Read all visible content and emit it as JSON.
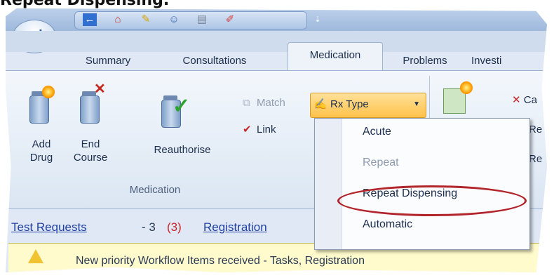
{
  "heading": "Repeat Dispensing.",
  "app": {
    "logo": "emis"
  },
  "qat": {
    "icons": [
      "back-arrow-icon",
      "home-icon",
      "pen-icon",
      "users-icon",
      "database-icon",
      "syringe-icon"
    ],
    "dropdown_glyph": "⇣"
  },
  "tabs": [
    "Summary",
    "Consultations",
    "Medication",
    "Problems",
    "Investi"
  ],
  "active_tab": "Medication",
  "ribbon": {
    "add_drug": [
      "Add",
      "Drug"
    ],
    "end_course": [
      "End",
      "Course"
    ],
    "reauthorise": "Reauthorise",
    "match": "Match",
    "link": "Link",
    "rx_type": "Rx Type",
    "group_label": "Medication",
    "right_partial": [
      "Ca",
      "Re",
      "Re"
    ]
  },
  "rx_menu": {
    "items": [
      {
        "label": "Acute",
        "enabled": true
      },
      {
        "label": "Repeat",
        "enabled": false
      },
      {
        "label": "Repeat Dispensing",
        "enabled": true,
        "highlighted": true
      },
      {
        "label": "Automatic",
        "enabled": true
      }
    ]
  },
  "links_bar": {
    "test_requests": "Test Requests",
    "dash_count": "- 3",
    "red_count": "(3)",
    "registration": "Registration"
  },
  "alert": {
    "text": "New priority Workflow Items received - Tasks, Registration"
  },
  "colors": {
    "highlight_oval": "#b1252b",
    "link": "#1f3fa1",
    "ribbon": "#dbe6f3",
    "rx_button": "#ffc24a"
  }
}
